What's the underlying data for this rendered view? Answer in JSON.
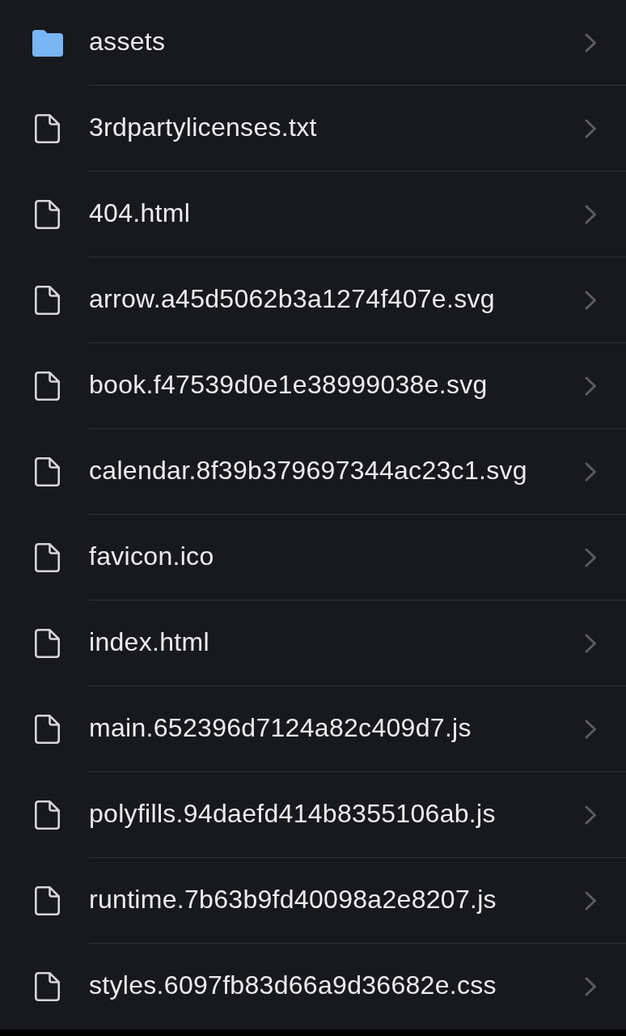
{
  "items": [
    {
      "name": "assets",
      "kind": "folder"
    },
    {
      "name": "3rdpartylicenses.txt",
      "kind": "file"
    },
    {
      "name": "404.html",
      "kind": "file"
    },
    {
      "name": "arrow.a45d5062b3a1274f407e.svg",
      "kind": "file"
    },
    {
      "name": "book.f47539d0e1e38999038e.svg",
      "kind": "file"
    },
    {
      "name": "calendar.8f39b379697344ac23c1.svg",
      "kind": "file"
    },
    {
      "name": "favicon.ico",
      "kind": "file"
    },
    {
      "name": "index.html",
      "kind": "file"
    },
    {
      "name": "main.652396d7124a82c409d7.js",
      "kind": "file"
    },
    {
      "name": "polyfills.94daefd414b8355106ab.js",
      "kind": "file"
    },
    {
      "name": "runtime.7b63b9fd40098a2e8207.js",
      "kind": "file"
    },
    {
      "name": "styles.6097fb83d66a9d36682e.css",
      "kind": "file"
    }
  ]
}
